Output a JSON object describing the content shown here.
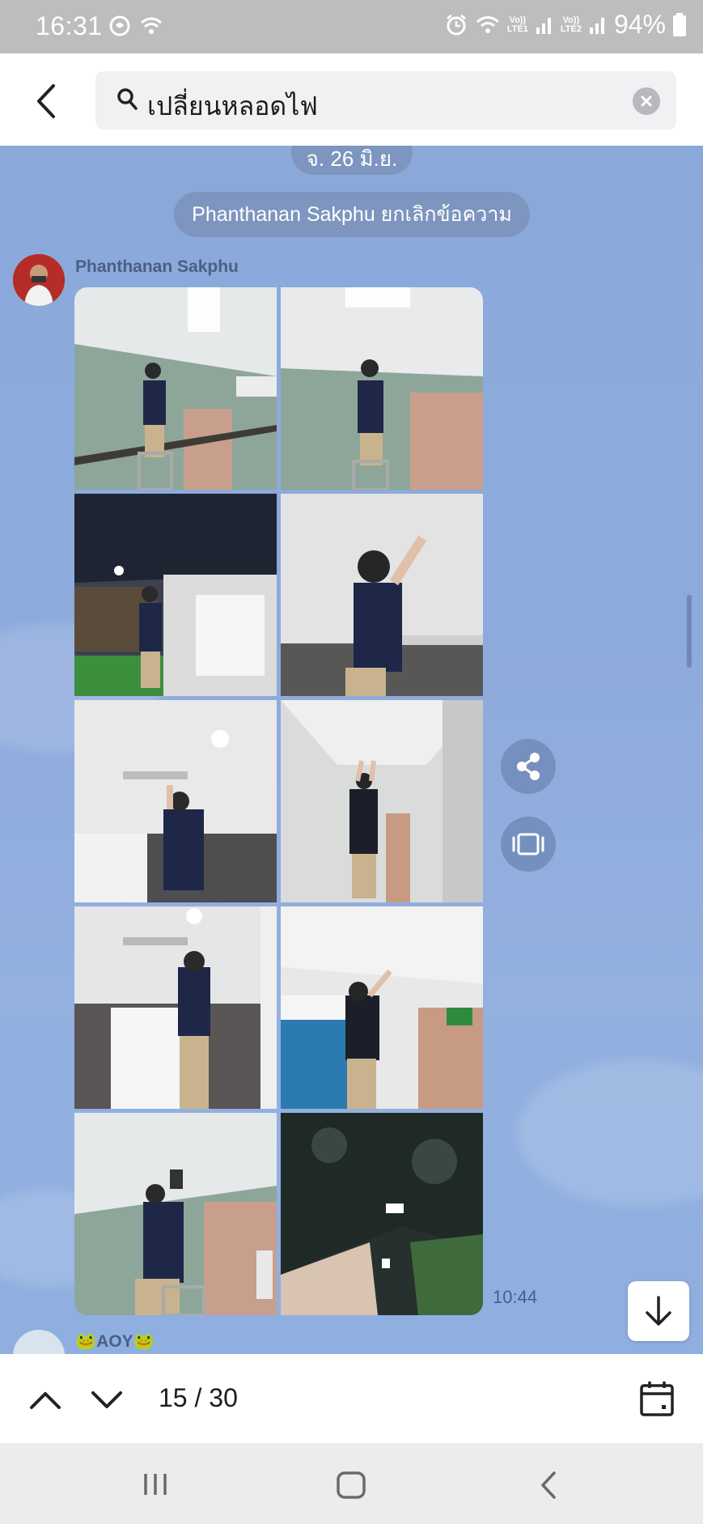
{
  "status_bar": {
    "time": "16:31",
    "battery": "94%",
    "sim1_top": "Vo))",
    "sim1_bottom": "LTE1",
    "sim2_top": "Vo))",
    "sim2_bottom": "LTE2"
  },
  "search": {
    "query": "เปลี่ยนหลอดไฟ"
  },
  "chat": {
    "date_chip": "จ. 26 มิ.ย.",
    "system_message": "Phanthanan Sakphu ยกเลิกข้อความ",
    "message": {
      "sender": "Phanthanan Sakphu",
      "photo_count": 10,
      "time": "10:44"
    },
    "next_sender": "🐸AOY🐸"
  },
  "toolbar": {
    "counter": "15 / 30"
  },
  "colors": {
    "chat_background": "#8aa9d9",
    "chip": "#7d95bf",
    "sender_text": "#4a5f86"
  },
  "icons": [
    "back-arrow-icon",
    "search-icon",
    "clear-icon",
    "share-icon",
    "slideshow-icon",
    "arrow-down-icon",
    "chevron-up-icon",
    "chevron-down-icon",
    "calendar-icon"
  ]
}
